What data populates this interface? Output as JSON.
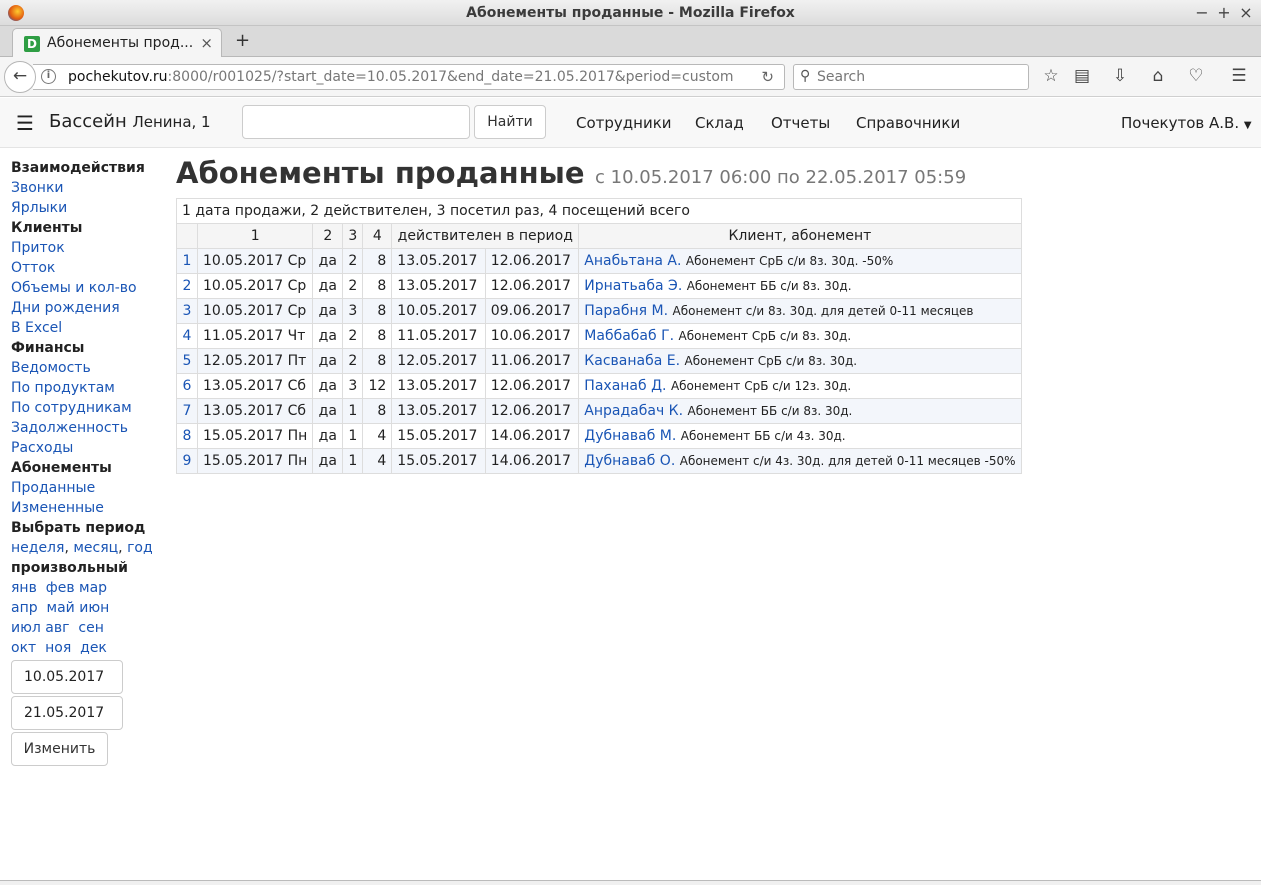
{
  "window": {
    "title": "Абонементы проданные - Mozilla Firefox"
  },
  "browser": {
    "tab_title": "Абонементы прод...",
    "favicon_letter": "D",
    "url_host": "pochekutov.ru",
    "url_rest": ":8000/r001025/?start_date=10.05.2017&end_date=21.05.2017&period=custom",
    "search_placeholder": "Search"
  },
  "app": {
    "brand": "Бассейн",
    "brand_sub": "Ленина, 1",
    "search_value": "",
    "find_label": "Найти",
    "nav": [
      "Сотрудники",
      "Склад",
      "Отчеты",
      "Справочники"
    ],
    "user": "Почекутов А.В."
  },
  "sidebar": {
    "s1": "Взаимодействия",
    "calls": "Звонки",
    "labels": "Ярлыки",
    "s2": "Клиенты",
    "inflow": "Приток",
    "outflow": "Отток",
    "volumes": "Объемы и кол-во",
    "birthdays": "Дни рождения",
    "excel": "В Excel",
    "s3": "Финансы",
    "statement": "Ведомость",
    "by_products": "По продуктам",
    "by_staff": "По сотрудникам",
    "debt": "Задолженность",
    "expenses": "Расходы",
    "s4": "Абонементы",
    "sold": "Проданные",
    "changed": "Измененные",
    "s5": "Выбрать период",
    "week": "неделя",
    "month": "месяц",
    "year": "год",
    "comma": ",",
    "custom": "произвольный",
    "months": [
      "янв",
      "фев",
      "мар",
      "апр",
      "май",
      "июн",
      "июл",
      "авг",
      "сен",
      "окт",
      "ноя",
      "дек"
    ],
    "start_date": "10.05.2017",
    "end_date": "21.05.2017",
    "change_label": "Изменить"
  },
  "main": {
    "title": "Абонементы проданные",
    "subtitle": "с 10.05.2017 06:00 по 22.05.2017 05:59",
    "caption": "1 дата продажи, 2 действителен, 3 посетил раз, 4 посещений всего",
    "headers": [
      "1",
      "2",
      "3",
      "4",
      "действителен в период",
      "Клиент, абонемент"
    ],
    "rows": [
      {
        "n": "1",
        "date": "10.05.2017 Ср",
        "valid": "да",
        "visited": "2",
        "total": "8",
        "from": "13.05.2017",
        "to": "12.06.2017",
        "client": "Анабьтана А.",
        "plan": "Абонемент СрБ с/и 8з. 30д. -50%"
      },
      {
        "n": "2",
        "date": "10.05.2017 Ср",
        "valid": "да",
        "visited": "2",
        "total": "8",
        "from": "13.05.2017",
        "to": "12.06.2017",
        "client": "Ирнатьаба Э.",
        "plan": "Абонемент ББ с/и 8з. 30д."
      },
      {
        "n": "3",
        "date": "10.05.2017 Ср",
        "valid": "да",
        "visited": "3",
        "total": "8",
        "from": "10.05.2017",
        "to": "09.06.2017",
        "client": "Парабня М.",
        "plan": "Абонемент с/и 8з. 30д. для детей 0-11 месяцев"
      },
      {
        "n": "4",
        "date": "11.05.2017 Чт",
        "valid": "да",
        "visited": "2",
        "total": "8",
        "from": "11.05.2017",
        "to": "10.06.2017",
        "client": "Маббабаб Г.",
        "plan": "Абонемент СрБ с/и 8з. 30д."
      },
      {
        "n": "5",
        "date": "12.05.2017 Пт",
        "valid": "да",
        "visited": "2",
        "total": "8",
        "from": "12.05.2017",
        "to": "11.06.2017",
        "client": "Касванаба Е.",
        "plan": "Абонемент СрБ с/и 8з. 30д."
      },
      {
        "n": "6",
        "date": "13.05.2017 Сб",
        "valid": "да",
        "visited": "3",
        "total": "12",
        "from": "13.05.2017",
        "to": "12.06.2017",
        "client": "Паханаб Д.",
        "plan": "Абонемент СрБ с/и 12з. 30д."
      },
      {
        "n": "7",
        "date": "13.05.2017 Сб",
        "valid": "да",
        "visited": "1",
        "total": "8",
        "from": "13.05.2017",
        "to": "12.06.2017",
        "client": "Анрадабач К.",
        "plan": "Абонемент ББ с/и 8з. 30д."
      },
      {
        "n": "8",
        "date": "15.05.2017 Пн",
        "valid": "да",
        "visited": "1",
        "total": "4",
        "from": "15.05.2017",
        "to": "14.06.2017",
        "client": "Дубнаваб М.",
        "plan": "Абонемент ББ с/и 4з. 30д."
      },
      {
        "n": "9",
        "date": "15.05.2017 Пн",
        "valid": "да",
        "visited": "1",
        "total": "4",
        "from": "15.05.2017",
        "to": "14.06.2017",
        "client": "Дубнаваб О.",
        "plan": "Абонемент с/и 4з. 30д. для детей 0-11 месяцев -50%"
      }
    ]
  }
}
